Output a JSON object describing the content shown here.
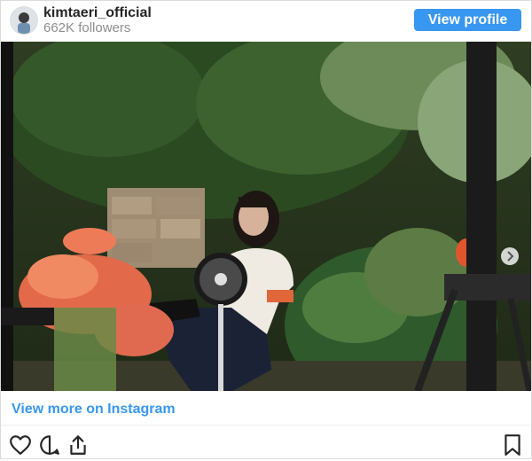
{
  "header": {
    "username": "kimtaeri_official",
    "followers": "662K followers",
    "view_profile_label": "View profile"
  },
  "footer": {
    "view_more_label": "View more on Instagram"
  },
  "icons": {
    "like": "heart-icon",
    "comment": "comment-icon",
    "share": "share-icon",
    "save": "bookmark-icon",
    "next": "chevron-right-icon"
  },
  "colors": {
    "accent": "#3897f0",
    "text": "#262626",
    "muted": "#8e8e8e"
  }
}
